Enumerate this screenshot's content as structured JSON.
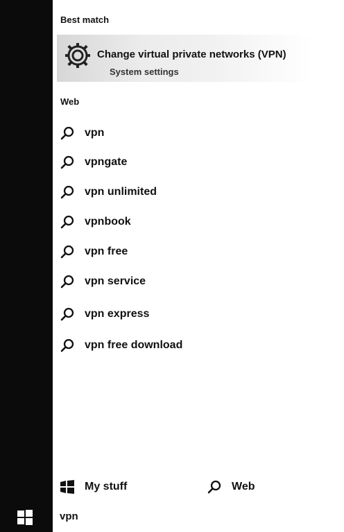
{
  "best_match": {
    "header": "Best match",
    "title": "Change virtual private networks (VPN)",
    "subtitle": "System settings",
    "icon": "gear-icon"
  },
  "web": {
    "header": "Web",
    "results": [
      {
        "label": "vpn",
        "icon": "search-icon"
      },
      {
        "label": "vpngate",
        "icon": "search-icon"
      },
      {
        "label": "vpn unlimited",
        "icon": "search-icon"
      },
      {
        "label": "vpnbook",
        "icon": "search-icon"
      },
      {
        "label": "vpn free",
        "icon": "search-icon"
      },
      {
        "label": "vpn service",
        "icon": "search-icon"
      },
      {
        "label": "vpn express",
        "icon": "search-icon"
      },
      {
        "label": "vpn free download",
        "icon": "search-icon"
      }
    ]
  },
  "bottom_tabs": {
    "my_stuff": {
      "label": "My stuff",
      "icon": "windows-flag-icon"
    },
    "web": {
      "label": "Web",
      "icon": "search-icon"
    }
  },
  "search": {
    "query": "vpn"
  },
  "colors": {
    "rail": "#0b0b0b",
    "background": "#ffffff",
    "text": "#111111"
  }
}
